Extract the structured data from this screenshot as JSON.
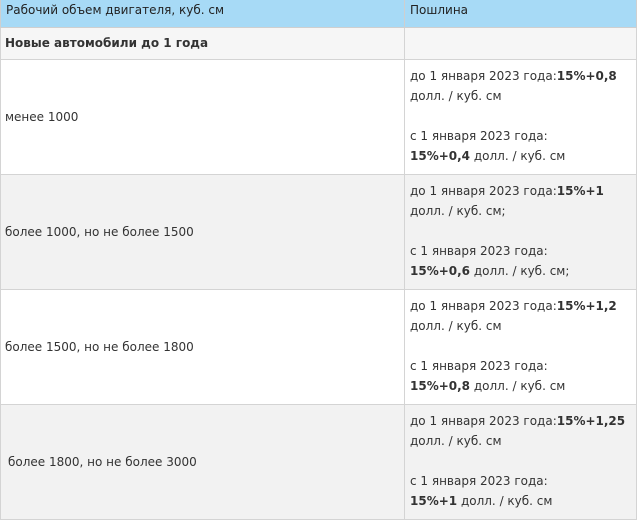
{
  "table": {
    "headers": [
      "Рабочий объем двигателя, куб. см",
      "Пошлина"
    ],
    "subheader": "Новые автомобили до 1 года",
    "rows": [
      {
        "volume": "менее 1000",
        "before_prefix": "до 1 января 2023 года:",
        "before_rate": "15%+0,8",
        "before_suffix": " долл. / куб. см",
        "after_prefix": "с 1 января 2023 года:",
        "after_rate": "15%+0,4",
        "after_suffix": " долл. / куб. см"
      },
      {
        "volume": "более 1000, но не более 1500",
        "before_prefix": "до 1 января 2023 года:",
        "before_rate": "15%+1",
        "before_suffix": " долл. / куб. см;",
        "after_prefix": "с 1 января 2023 года:",
        "after_rate": "15%+0,6",
        "after_suffix": " долл. / куб. см;"
      },
      {
        "volume": "более 1500, но не более 1800",
        "before_prefix": "до 1 января 2023 года:",
        "before_rate": "15%+1,2",
        "before_suffix": " долл. / куб. см",
        "after_prefix": "с 1 января 2023 года:",
        "after_rate": "15%+0,8",
        "after_suffix": " долл. / куб. см"
      },
      {
        "volume": "более 1800, но не более 3000",
        "before_prefix": "до 1 января 2023 года:",
        "before_rate": "15%+1,25",
        "before_suffix": " долл. / куб. см",
        "after_prefix": "с 1 января 2023 года:",
        "after_rate": "15%+1",
        "after_suffix": " долл. / куб. см"
      }
    ]
  }
}
